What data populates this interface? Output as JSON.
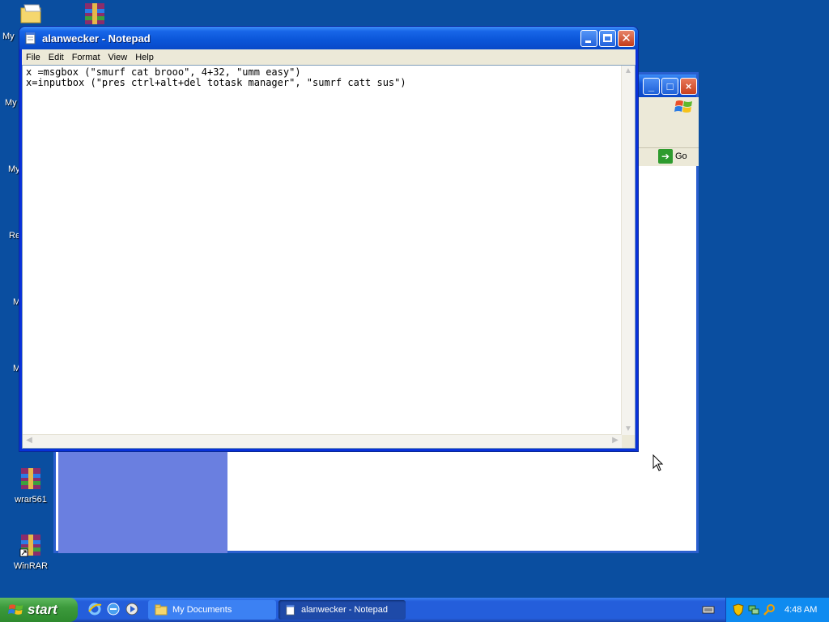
{
  "desktop": {
    "icons": [
      {
        "label": "wrar561"
      },
      {
        "label": "WinRAR"
      }
    ],
    "partial_labels": [
      "My",
      "My",
      "My",
      "Re",
      "M",
      "M"
    ]
  },
  "background_window": {
    "go_label": "Go"
  },
  "notepad": {
    "title": "alanwecker - Notepad",
    "menu": [
      "File",
      "Edit",
      "Format",
      "View",
      "Help"
    ],
    "text": "x =msgbox (\"smurf cat brooo\", 4+32, \"umm easy\")\nx=inputbox (\"pres ctrl+alt+del totask manager\", \"sumrf catt sus\")"
  },
  "taskbar": {
    "start_label": "start",
    "tasks": [
      {
        "label": "My Documents",
        "active": false
      },
      {
        "label": "alanwecker - Notepad",
        "active": true
      }
    ],
    "clock": "4:48 AM"
  }
}
